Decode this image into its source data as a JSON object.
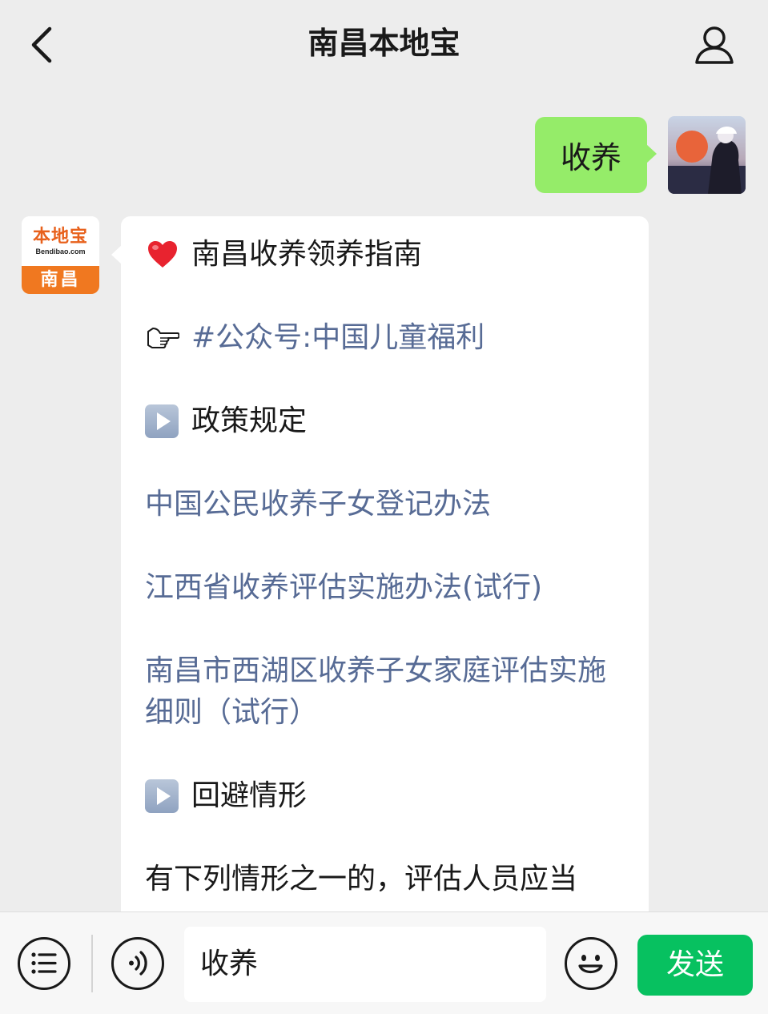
{
  "header": {
    "title": "南昌本地宝",
    "back_icon": "chevron-left-icon",
    "profile_icon": "person-icon"
  },
  "user_message": {
    "text": "收养"
  },
  "bot": {
    "logo_main": "本地宝",
    "logo_sub": "Bendibao.com",
    "logo_city": "南昌"
  },
  "bot_message": {
    "title": "南昌收养领养指南",
    "account_link": "#公众号:中国儿童福利",
    "section_policy": "政策规定",
    "links": [
      "中国公民收养子女登记办法",
      "江西省收养评估实施办法(试行)",
      "南昌市西湖区收养子女家庭评估实施细则（试行）"
    ],
    "section_avoid": "回避情形",
    "body_start": "有下列情形之一的，评估人员应当"
  },
  "bottom_bar": {
    "input_value": "收养",
    "send_label": "发送"
  },
  "colors": {
    "background": "#ededed",
    "user_bubble": "#95ec69",
    "link": "#576b95",
    "send_button": "#07c160",
    "brand_orange": "#f07820"
  }
}
